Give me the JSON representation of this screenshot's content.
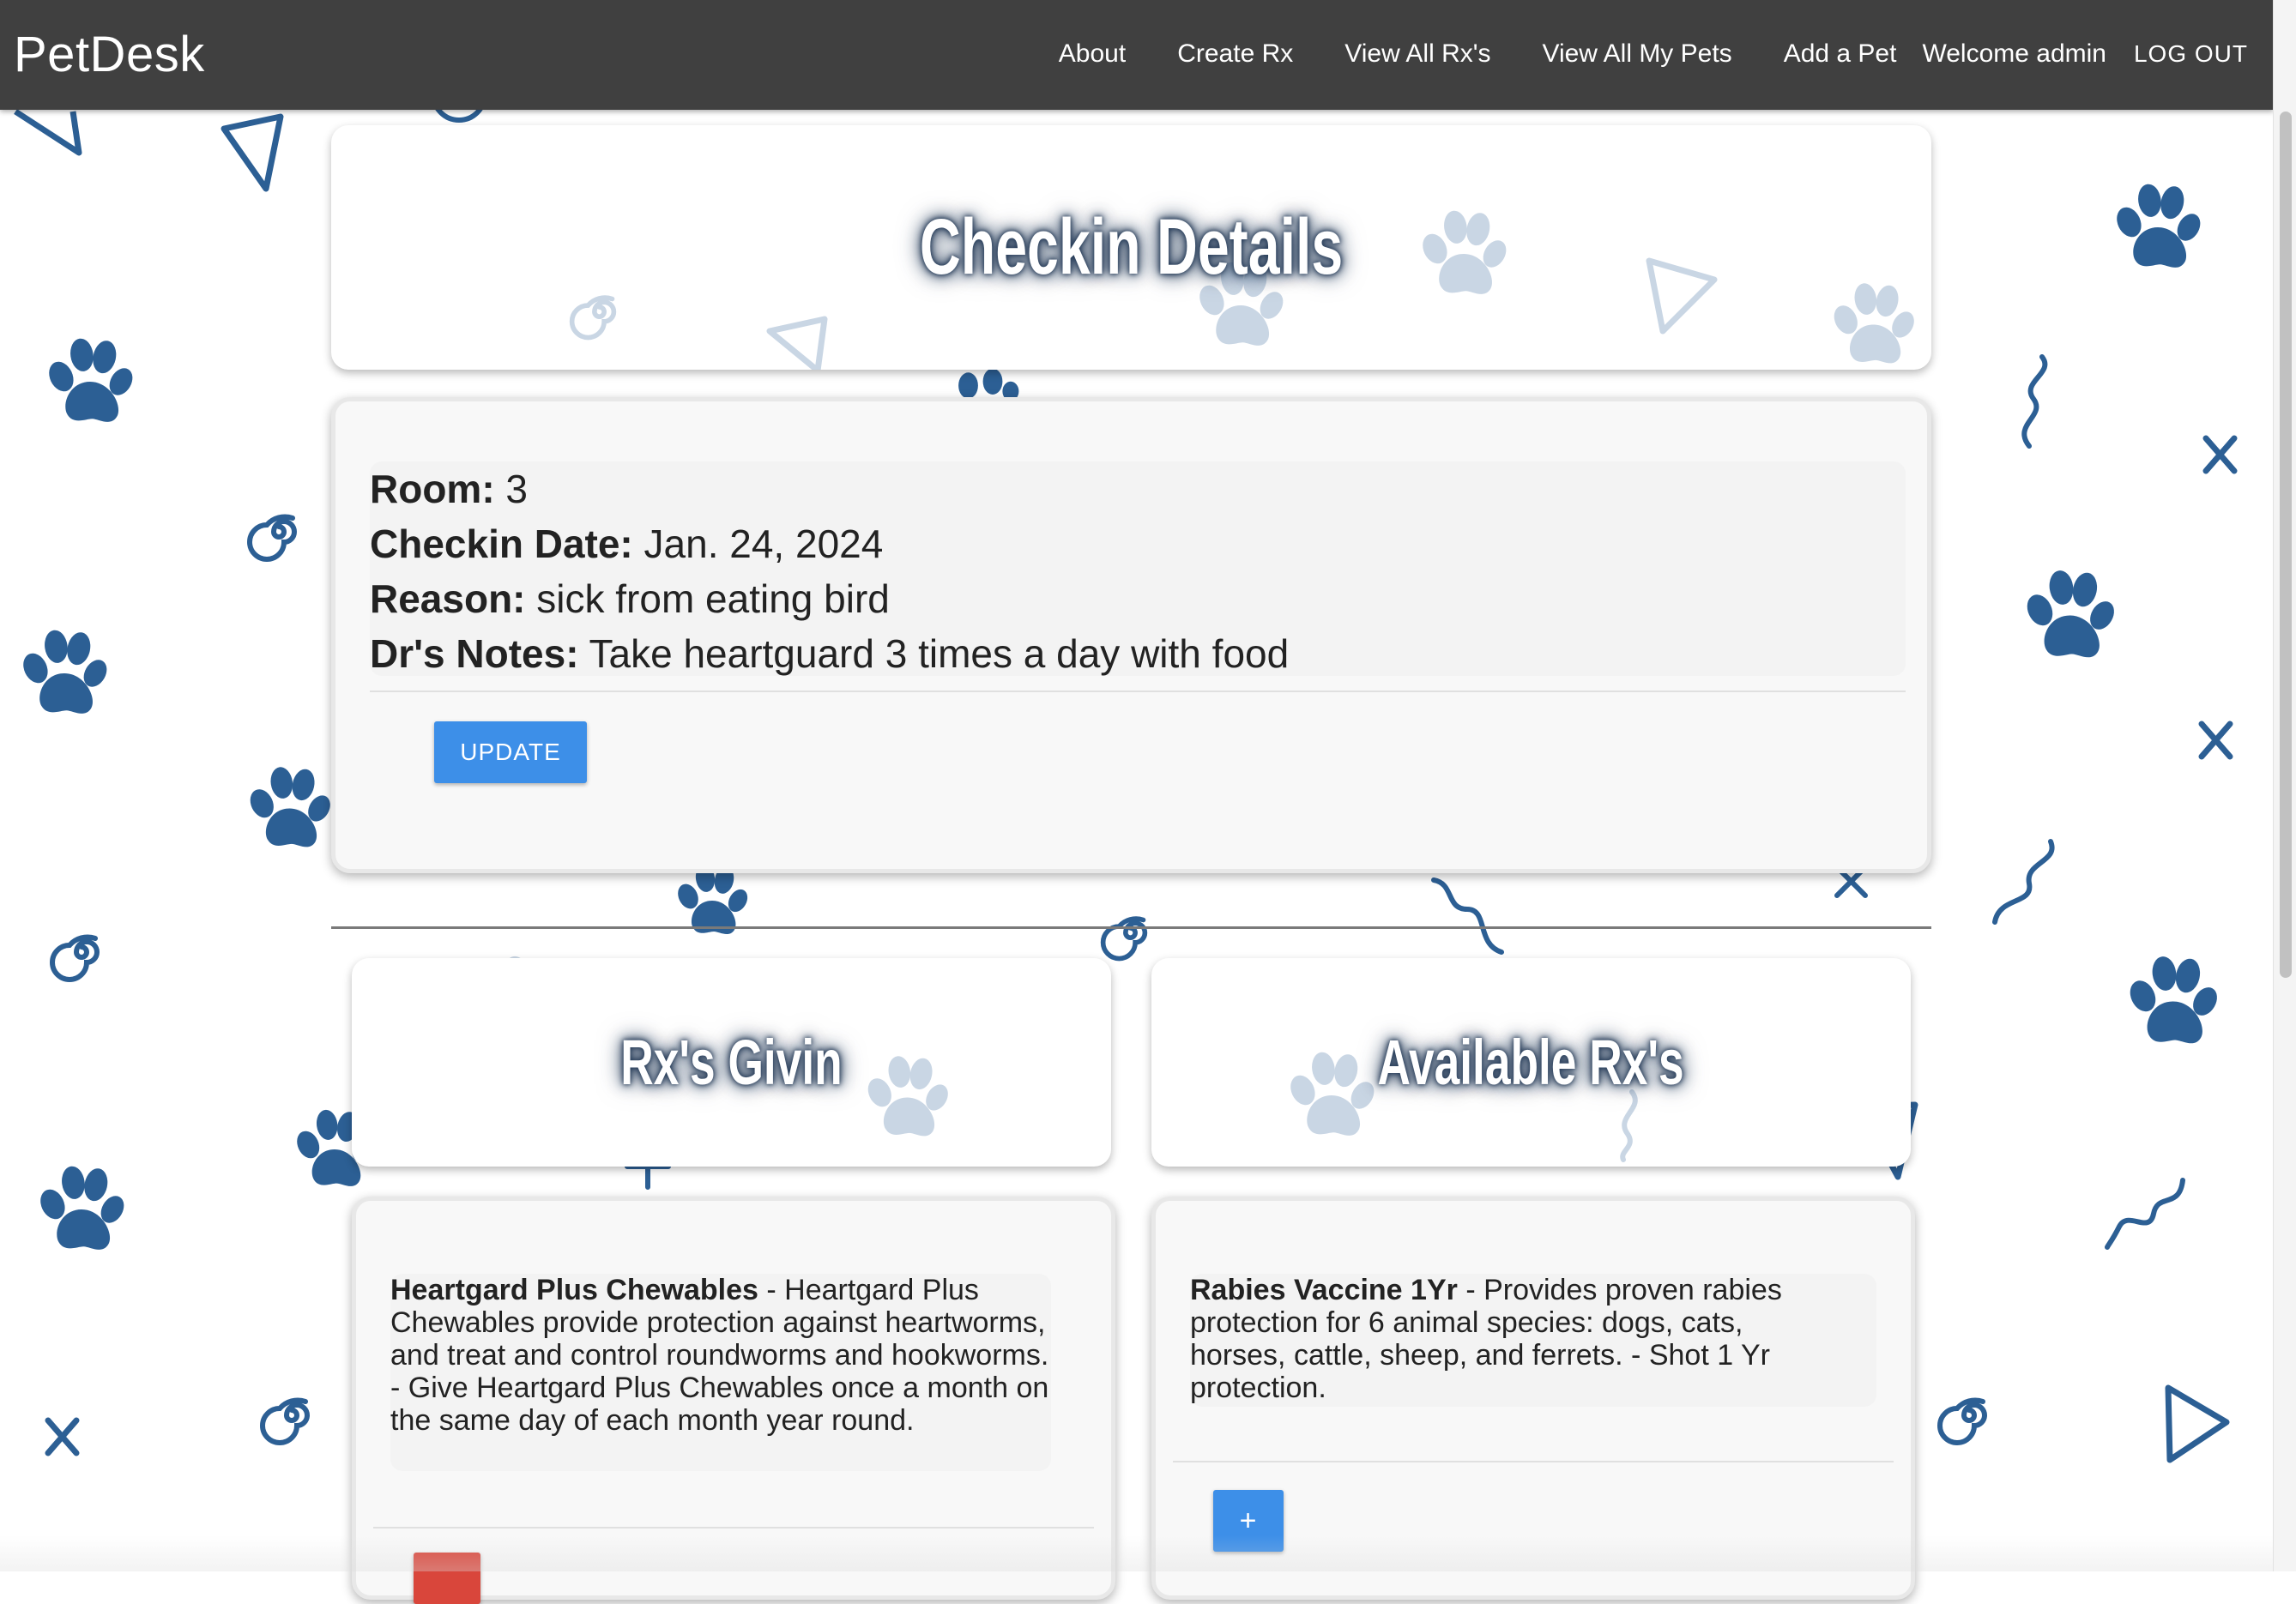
{
  "navbar": {
    "brand": "PetDesk",
    "links": [
      "About",
      "Create Rx",
      "View All Rx's",
      "View All My Pets",
      "Add a Pet"
    ],
    "welcome": "Welcome admin",
    "logout": "LOG OUT"
  },
  "header": {
    "title": "Checkin Details"
  },
  "checkin": {
    "room_label": "Room:",
    "room_value": " 3",
    "date_label": "Checkin Date:",
    "date_value": " Jan. 24, 2024",
    "reason_label": "Reason:",
    "reason_value": " sick from eating bird",
    "notes_label": "Dr's Notes:",
    "notes_value": " Take heartguard 3 times a day with food",
    "update_label": "UPDATE"
  },
  "rx_givin": {
    "title": "Rx's Givin",
    "items": [
      {
        "name": "Heartgard Plus Chewables",
        "description": " - Heartgard Plus Chewables provide protection against heartworms, and treat and control roundworms and hookworms. - Give Heartgard Plus Chewables once a month on the same day of each month year round."
      }
    ]
  },
  "available_rx": {
    "title": "Available Rx's",
    "items": [
      {
        "name": "Rabies Vaccine 1Yr",
        "description": " - Provides proven rabies protection for 6 animal species: dogs, cats, horses, cattle, sheep, and ferrets. - Shot 1 Yr protection.",
        "add_label": "+"
      }
    ]
  },
  "colors": {
    "navbar": "#404040",
    "accent_blue": "#3d8fe8",
    "remove_red": "#d9463b",
    "decoration_blue": "#2c5f94"
  },
  "icons": [
    "paw-icon",
    "triangle-icon",
    "spiral-icon",
    "squiggle-icon",
    "x-mark-icon",
    "plus-mark-icon"
  ]
}
